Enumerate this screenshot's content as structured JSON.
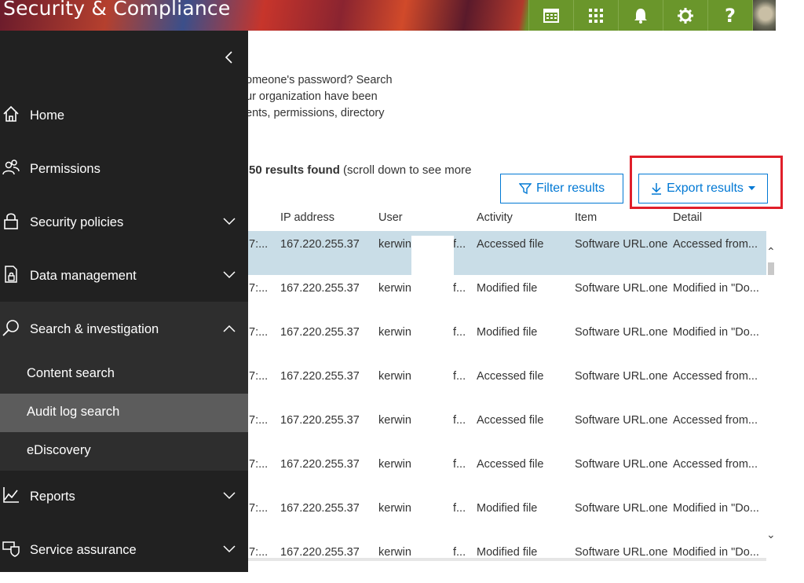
{
  "header": {
    "title": "Security & Compliance",
    "icons": [
      "calendar-icon",
      "app-launcher-icon",
      "bell-icon",
      "gear-icon",
      "help-icon"
    ],
    "help_glyph": "?"
  },
  "description": {
    "lines": [
      "omeone's password? Search",
      "ur organization have been",
      "ents, permissions, directory"
    ]
  },
  "results": {
    "count_text": "50 results found",
    "hint_text": "(scroll down to see more"
  },
  "buttons": {
    "filter_label": "Filter results",
    "export_label": "Export results"
  },
  "table": {
    "columns": [
      "IP address",
      "User",
      "Activity",
      "Item",
      "Detail"
    ],
    "rows": [
      {
        "date": "7:...",
        "ip": "167.220.255.37",
        "user": "kerwin",
        "extra": "f...",
        "activity": "Accessed file",
        "item": "Software URL.one",
        "detail": "Accessed from...",
        "selected": true
      },
      {
        "date": "7:...",
        "ip": "167.220.255.37",
        "user": "kerwin",
        "extra": "f...",
        "activity": "Modified file",
        "item": "Software URL.one",
        "detail": "Modified in \"Do..."
      },
      {
        "date": "7:...",
        "ip": "167.220.255.37",
        "user": "kerwin",
        "extra": "f...",
        "activity": "Modified file",
        "item": "Software URL.one",
        "detail": "Modified in \"Do..."
      },
      {
        "date": "7:...",
        "ip": "167.220.255.37",
        "user": "kerwin",
        "extra": "f...",
        "activity": "Accessed file",
        "item": "Software URL.one",
        "detail": "Accessed from..."
      },
      {
        "date": "7:...",
        "ip": "167.220.255.37",
        "user": "kerwin",
        "extra": "f...",
        "activity": "Accessed file",
        "item": "Software URL.one",
        "detail": "Accessed from..."
      },
      {
        "date": "7:...",
        "ip": "167.220.255.37",
        "user": "kerwin",
        "extra": "f...",
        "activity": "Accessed file",
        "item": "Software URL.one",
        "detail": "Accessed from..."
      },
      {
        "date": "7:...",
        "ip": "167.220.255.37",
        "user": "kerwin",
        "extra": "f...",
        "activity": "Modified file",
        "item": "Software URL.one",
        "detail": "Modified in \"Do..."
      },
      {
        "date": "7:...",
        "ip": "167.220.255.37",
        "user": "kerwin",
        "extra": "f...",
        "activity": "Modified file",
        "item": "Software URL.one",
        "detail": "Modified in \"Do..."
      }
    ]
  },
  "sidebar": {
    "items": [
      {
        "label": "Home",
        "icon": "home-icon"
      },
      {
        "label": "Permissions",
        "icon": "people-icon"
      },
      {
        "label": "Security policies",
        "icon": "lock-icon",
        "expandable": true
      },
      {
        "label": "Data management",
        "icon": "document-lock-icon",
        "expandable": true
      },
      {
        "label": "Search & investigation",
        "icon": "search-icon",
        "expandable": true,
        "expanded": true
      },
      {
        "label": "Reports",
        "icon": "chart-icon",
        "expandable": true
      },
      {
        "label": "Service assurance",
        "icon": "shield-icon",
        "expandable": true
      }
    ],
    "subitems": [
      {
        "label": "Content search"
      },
      {
        "label": "Audit log search",
        "selected": true
      },
      {
        "label": "eDiscovery"
      }
    ]
  },
  "colors": {
    "accent": "#0078d4",
    "sidebar_bg": "#212121",
    "selected_row": "#c9dde7",
    "highlight_box": "#e01f2a",
    "header_green": "#6a962b"
  }
}
